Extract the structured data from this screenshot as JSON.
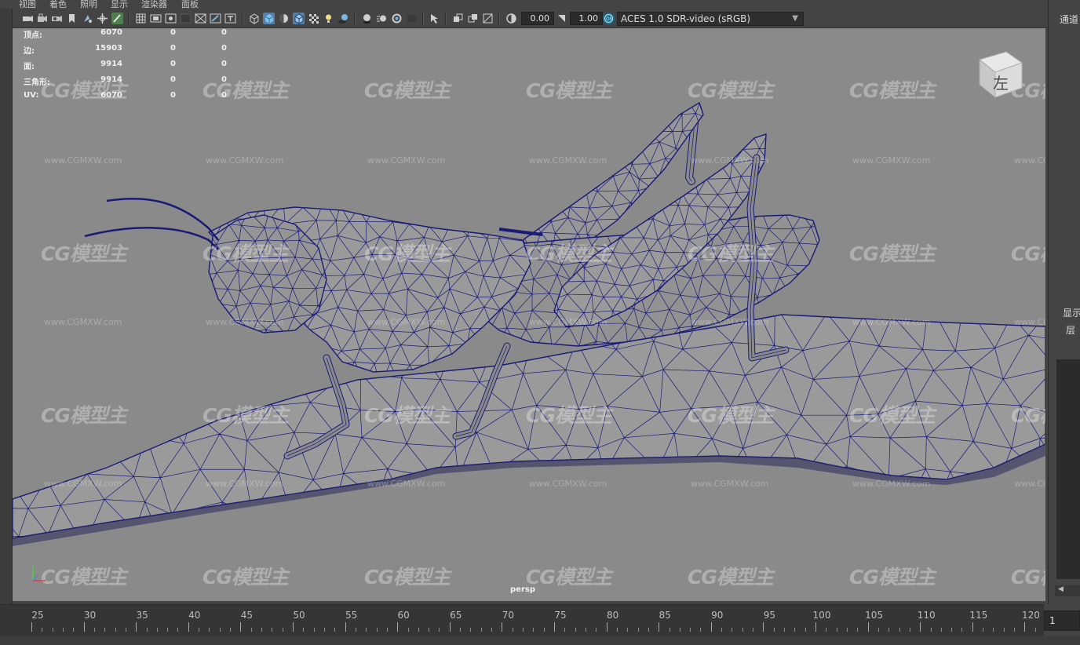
{
  "menu": [
    "视图",
    "着色",
    "照明",
    "显示",
    "渲染器",
    "面板"
  ],
  "toolbar": {
    "exposure_value": "0.00",
    "gamma_value": "1.00",
    "color_space": "ACES 1.0 SDR-video (sRGB)"
  },
  "hud": {
    "rows": [
      {
        "label": "顶点:",
        "v1": "6070",
        "v2": "0",
        "v3": "0"
      },
      {
        "label": "边:",
        "v1": "15903",
        "v2": "0",
        "v3": "0"
      },
      {
        "label": "面:",
        "v1": "9914",
        "v2": "0",
        "v3": "0"
      },
      {
        "label": "三角形:",
        "v1": "9914",
        "v2": "0",
        "v3": "0"
      },
      {
        "label": "UV:",
        "v1": "6070",
        "v2": "0",
        "v3": "0"
      }
    ]
  },
  "viewport": {
    "camera": "persp",
    "view_cube_label": "左",
    "watermark_logo": "CG模型主",
    "watermark_url": "www.CGMXW.com",
    "wire_color": "#1a1a78",
    "background_color": "#8a8a8a"
  },
  "right_panel": {
    "channels_label": "通道",
    "display_tab": "显示",
    "layer_label": "层"
  },
  "timeline": {
    "ticks": [
      "25",
      "30",
      "35",
      "40",
      "45",
      "50",
      "55",
      "60",
      "65",
      "70",
      "75",
      "80",
      "85",
      "90",
      "95",
      "100",
      "105",
      "110",
      "115",
      "120"
    ],
    "current_frame": "1"
  }
}
